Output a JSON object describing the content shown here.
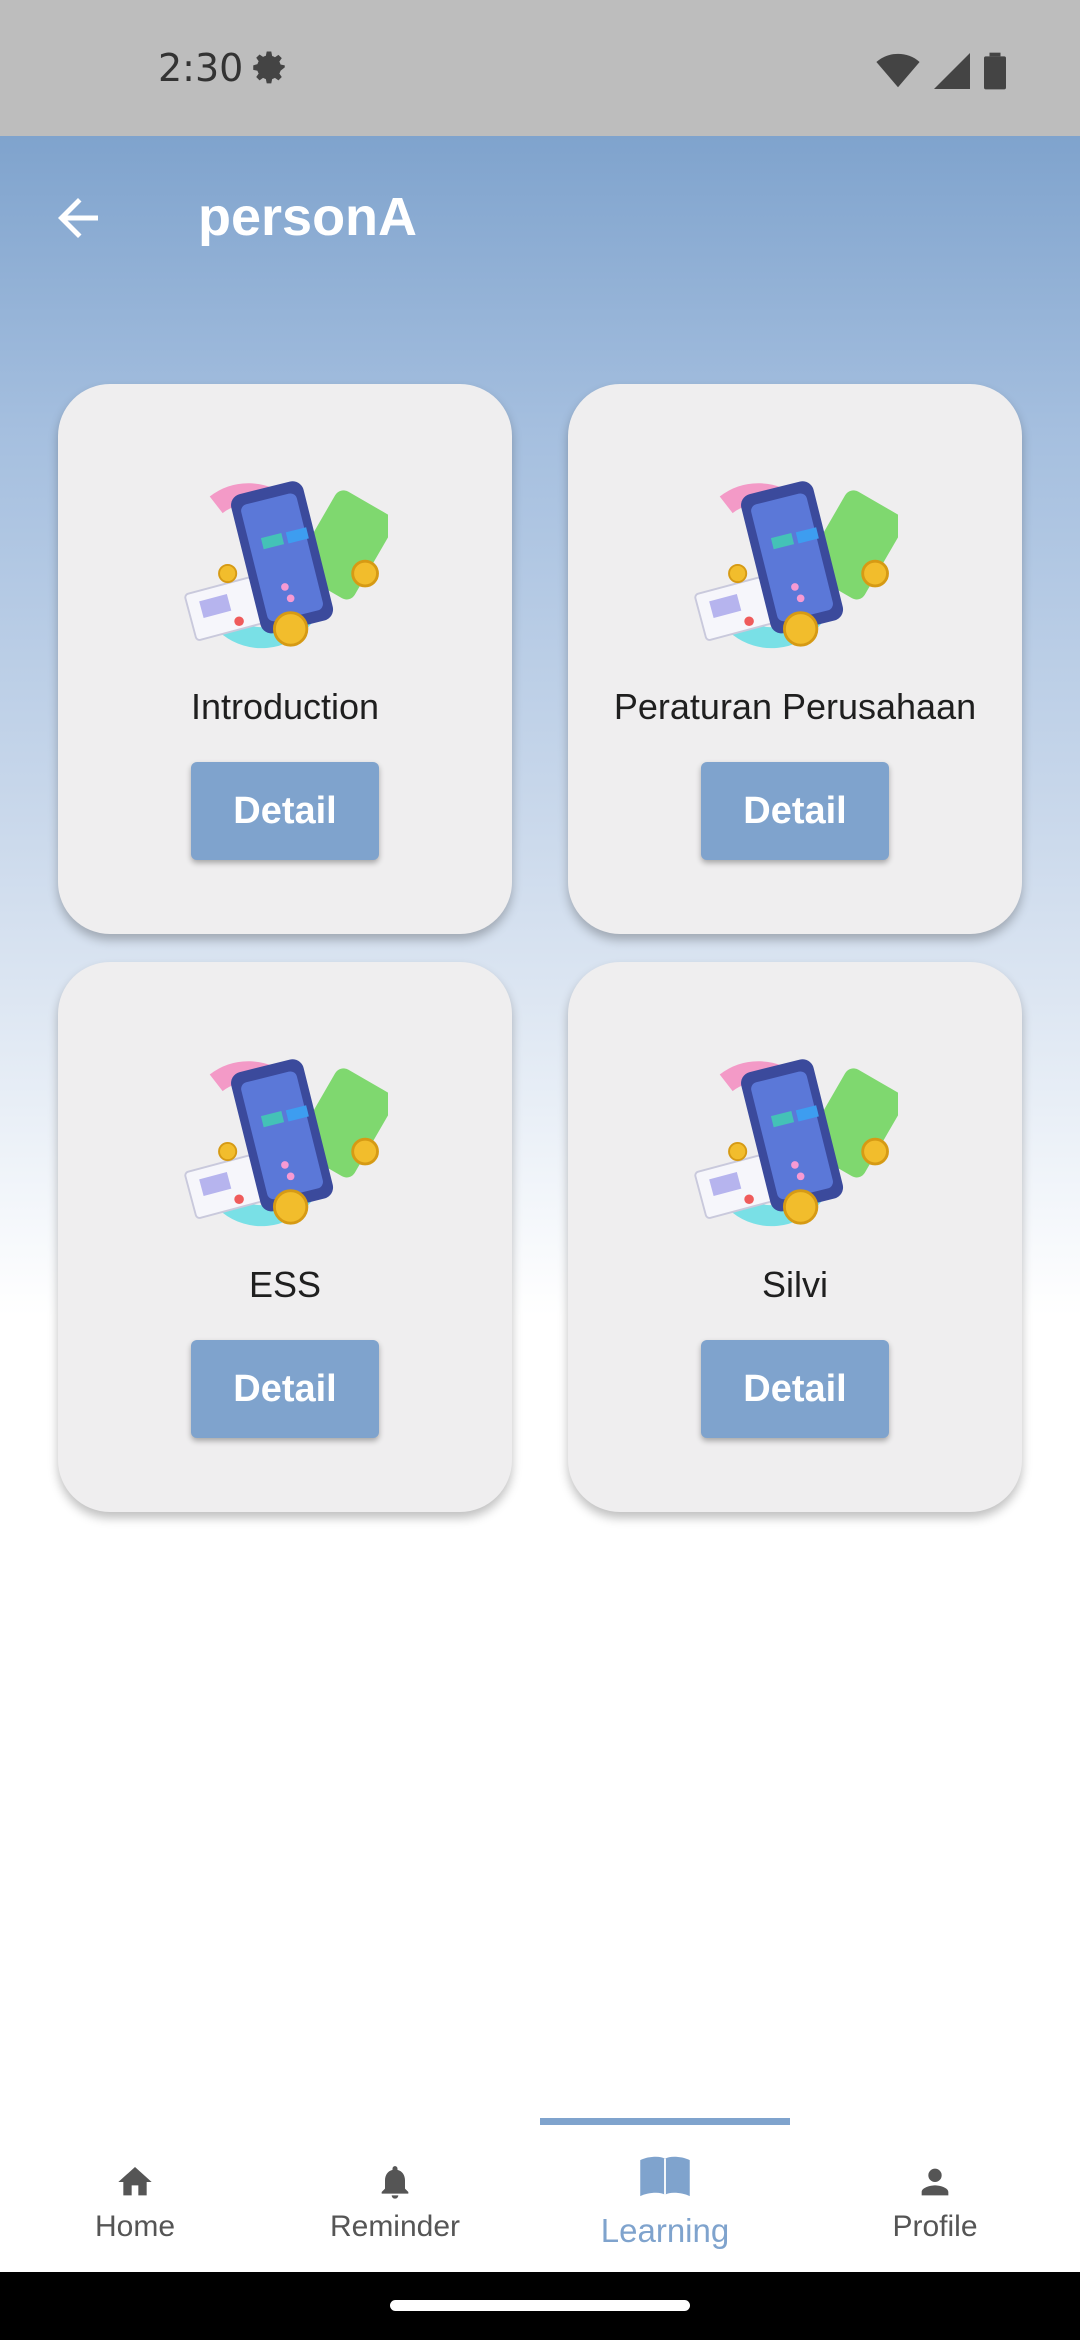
{
  "status_bar": {
    "time": "2:30"
  },
  "app_bar": {
    "title": "personA"
  },
  "cards": [
    {
      "title": "Introduction",
      "button": "Detail"
    },
    {
      "title": "Peraturan Perusahaan",
      "button": "Detail"
    },
    {
      "title": "ESS",
      "button": "Detail"
    },
    {
      "title": "Silvi",
      "button": "Detail"
    }
  ],
  "bottom_nav": {
    "items": [
      {
        "label": "Home",
        "icon": "home-icon"
      },
      {
        "label": "Reminder",
        "icon": "bell-icon"
      },
      {
        "label": "Learning",
        "icon": "book-icon",
        "active": true
      },
      {
        "label": "Profile",
        "icon": "person-icon"
      }
    ]
  },
  "colors": {
    "accent": "#7fa3cd",
    "card": "#efeeef",
    "status_bar": "#bdbdbd"
  }
}
